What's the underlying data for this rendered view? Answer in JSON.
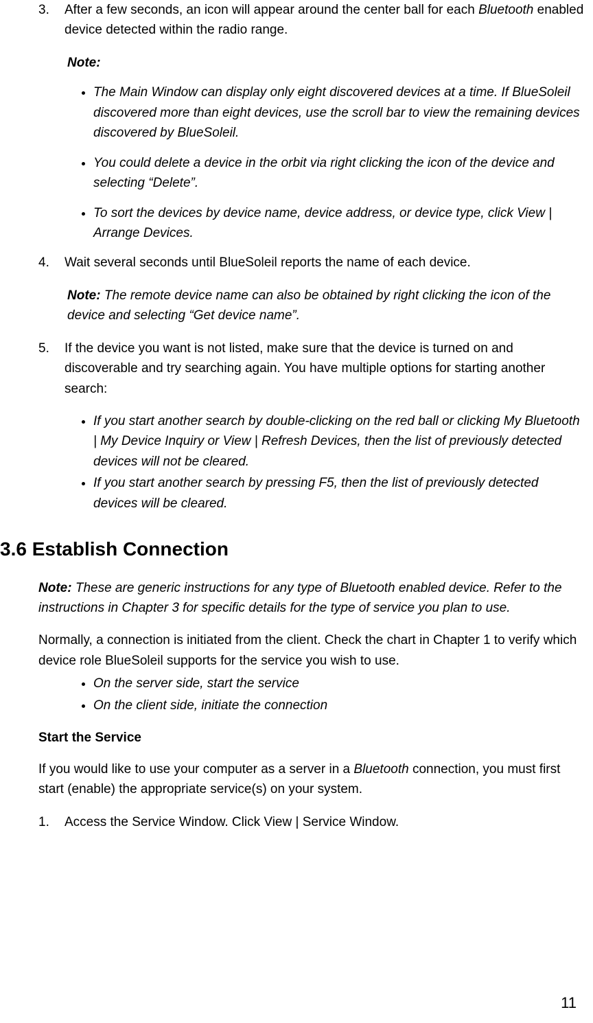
{
  "step3": {
    "marker": "3.",
    "text_pre": "After a few seconds, an icon will appear around the center ball for each ",
    "bt": "Bluetooth",
    "text_post": " enabled device detected within the radio range."
  },
  "noteLabel": "Note:",
  "noteBullets": [
    "The Main Window can display only eight discovered devices at a time. If BlueSoleil discovered more than eight devices, use the scroll bar to view the remaining devices discovered by BlueSoleil.",
    "You could delete a device in the orbit via right clicking the icon of the device and selecting “Delete”.",
    "To sort the devices by device name, device address, or device type, click View | Arrange Devices."
  ],
  "step4": {
    "marker": "4.",
    "text": "Wait several seconds until BlueSoleil reports the name of each device."
  },
  "note4": {
    "label": "Note:",
    "text": " The remote device name can also be obtained by right clicking the icon of the device and selecting “Get device name”."
  },
  "step5": {
    "marker": "5.",
    "text": "If the device you want is not listed, make sure that the device is turned on and discoverable and try searching again. You have multiple options for starting another search:"
  },
  "searchBullets": [
    "If you start another search by double-clicking on the red ball or clicking My Bluetooth | My Device Inquiry or View | Refresh Devices, then the list of previously detected devices will not be cleared.",
    "If you start another search by pressing F5, then the list of previously detected devices will be cleared."
  ],
  "sectionHeading": "3.6 Establish Connection",
  "sectionNote": {
    "label": "Note:",
    "text": " These are generic instructions for any type of Bluetooth enabled device. Refer to the instructions in Chapter 3 for specific details for the type of service you plan to use."
  },
  "normally": "Normally, a connection is initiated from the client. Check the chart in Chapter 1 to verify which device role BlueSoleil supports for the service you wish to use.",
  "sideBullets": [
    "On the server side, start the service",
    "On the client side, initiate the connection"
  ],
  "startService": "Start the Service",
  "startServiceBody_pre": "If you would like to use your computer as a server in a ",
  "startServiceBody_bt": "Bluetooth",
  "startServiceBody_post": " connection, you must first start (enable) the appropriate service(s) on your system.",
  "step1": {
    "marker": "1.",
    "text": "Access the Service Window. Click View | Service Window."
  },
  "pageNumber": "11"
}
